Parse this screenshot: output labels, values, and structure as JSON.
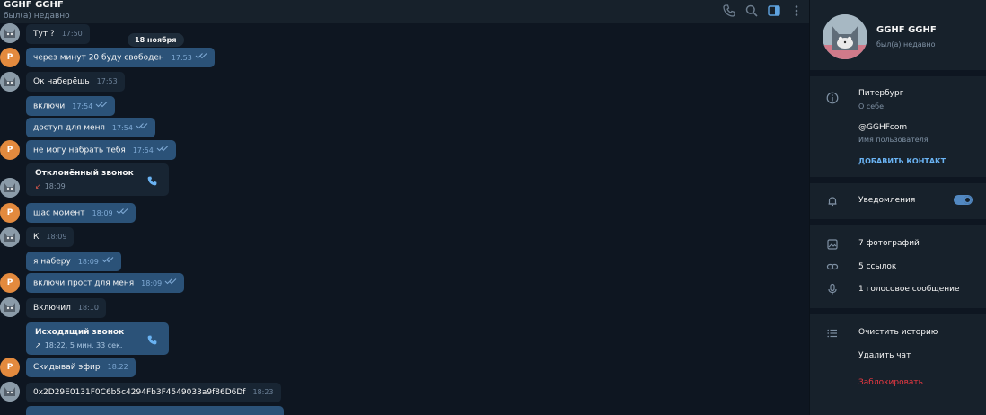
{
  "header": {
    "name": "GGHF GGHF",
    "status": "был(а) недавно",
    "icons": [
      "phone-icon",
      "search-icon",
      "sidebar-toggle-icon",
      "more-vertical-icon"
    ]
  },
  "date_separator": "18 ноября",
  "messages": [
    {
      "text": "Тут ?",
      "time": "17:50",
      "dir": "in"
    },
    {
      "text": "через минут 20 буду свободен",
      "time": "17:53",
      "dir": "out"
    },
    {
      "text": "Ок наберёшь",
      "time": "17:53",
      "dir": "in"
    },
    {
      "text": "включи",
      "time": "17:54",
      "dir": "out"
    },
    {
      "text": "доступ для меня",
      "time": "17:54",
      "dir": "out"
    },
    {
      "text": "не могу набрать тебя",
      "time": "17:54",
      "dir": "out"
    },
    {
      "text": "щас момент",
      "time": "18:09",
      "dir": "out"
    },
    {
      "text": "К",
      "time": "18:09",
      "dir": "in"
    },
    {
      "text": "я наберу",
      "time": "18:09",
      "dir": "out"
    },
    {
      "text": "включи прост для меня",
      "time": "18:09",
      "dir": "out"
    },
    {
      "text": "Включил",
      "time": "18:10",
      "dir": "in"
    },
    {
      "text": "Скидывай эфир",
      "time": "18:22",
      "dir": "out"
    },
    {
      "text": "0x2D29E0131F0C6b5c4294Fb3F4549033a9f86D6Df",
      "time": "18:23",
      "dir": "in"
    }
  ],
  "calls": [
    {
      "title": "Отклонённый звонок",
      "sub": "18:09",
      "arrow": "↙"
    },
    {
      "title": "Исходящий звонок",
      "sub": "18:22, 5 мин. 33 сек.",
      "arrow": "↗"
    }
  ],
  "avatar_letter": "Р",
  "profile": {
    "name": "GGHF GGHF",
    "status": "был(а) недавно",
    "bio": "Питербург",
    "bio_label": "О себе",
    "username": "@GGHFcom",
    "username_label": "Имя пользователя",
    "add_contact": "ДОБАВИТЬ КОНТАКТ",
    "notifications": "Уведомления",
    "notifications_on": true,
    "photos": "7 фотографий",
    "links": "5 ссылок",
    "voice": "1 голосовое сообщение",
    "clear_history": "Очистить историю",
    "delete_chat": "Удалить чат",
    "block": "Заблокировать"
  },
  "colors": {
    "bg": "#0e1621",
    "panel": "#17212b",
    "incoming": "#182533",
    "outgoing": "#2b5278",
    "accent": "#6ab3f3",
    "danger": "#ec3942",
    "avatar_orange": "#e38a3e"
  }
}
